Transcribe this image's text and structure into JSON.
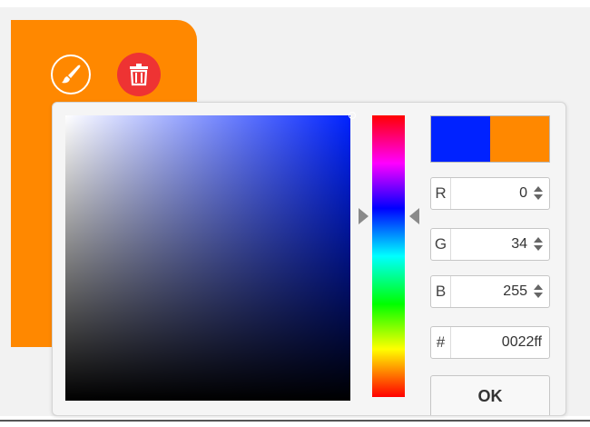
{
  "colors": {
    "card_accent": "#ff8800",
    "delete_red": "#ee3333",
    "selected": "#0022ff",
    "previous": "#ff8800"
  },
  "card": {
    "edit_icon": "brush-icon",
    "delete_icon": "trash-icon"
  },
  "picker": {
    "rgb": [
      {
        "label": "R",
        "value": "0"
      },
      {
        "label": "G",
        "value": "34"
      },
      {
        "label": "B",
        "value": "255"
      }
    ],
    "hex": {
      "label": "#",
      "value": "0022ff"
    },
    "ok_label": "OK"
  }
}
